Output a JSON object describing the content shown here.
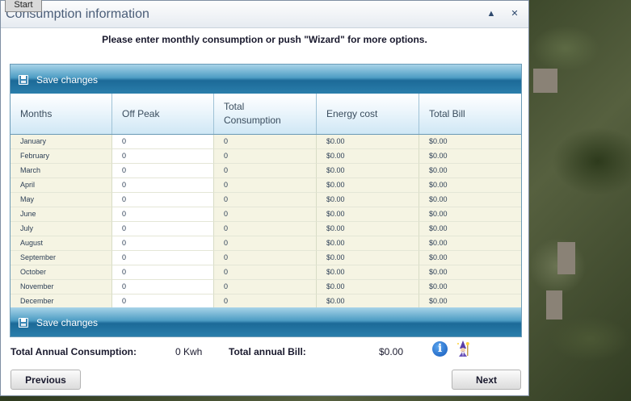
{
  "taskbar": {
    "start_label": "Start"
  },
  "dialog": {
    "title": "Consumption information",
    "collapse_glyph": "▲",
    "close_glyph": "✕",
    "instruction": "Please enter monthly consumption or push \"Wizard\" for more options."
  },
  "grid": {
    "save_label": "Save changes",
    "columns": [
      "Months",
      "Off Peak",
      "Total Consumption",
      "Energy cost",
      "Total Bill"
    ],
    "rows": [
      {
        "month": "January",
        "off_peak": "0",
        "total": "0",
        "energy": "$0.00",
        "bill": "$0.00"
      },
      {
        "month": "February",
        "off_peak": "0",
        "total": "0",
        "energy": "$0.00",
        "bill": "$0.00"
      },
      {
        "month": "March",
        "off_peak": "0",
        "total": "0",
        "energy": "$0.00",
        "bill": "$0.00"
      },
      {
        "month": "April",
        "off_peak": "0",
        "total": "0",
        "energy": "$0.00",
        "bill": "$0.00"
      },
      {
        "month": "May",
        "off_peak": "0",
        "total": "0",
        "energy": "$0.00",
        "bill": "$0.00"
      },
      {
        "month": "June",
        "off_peak": "0",
        "total": "0",
        "energy": "$0.00",
        "bill": "$0.00"
      },
      {
        "month": "July",
        "off_peak": "0",
        "total": "0",
        "energy": "$0.00",
        "bill": "$0.00"
      },
      {
        "month": "August",
        "off_peak": "0",
        "total": "0",
        "energy": "$0.00",
        "bill": "$0.00"
      },
      {
        "month": "September",
        "off_peak": "0",
        "total": "0",
        "energy": "$0.00",
        "bill": "$0.00"
      },
      {
        "month": "October",
        "off_peak": "0",
        "total": "0",
        "energy": "$0.00",
        "bill": "$0.00"
      },
      {
        "month": "November",
        "off_peak": "0",
        "total": "0",
        "energy": "$0.00",
        "bill": "$0.00"
      },
      {
        "month": "December",
        "off_peak": "0",
        "total": "0",
        "energy": "$0.00",
        "bill": "$0.00"
      }
    ]
  },
  "summary": {
    "consumption_label": "Total Annual Consumption:",
    "consumption_value": "0 Kwh",
    "bill_label": "Total annual Bill:",
    "bill_value": "$0.00"
  },
  "icons": {
    "info": "info-icon",
    "wizard": "wizard-icon"
  },
  "info_glyph": "i",
  "nav": {
    "previous_label": "Previous",
    "next_label": "Next"
  },
  "colors": {
    "toolbar": "#2a7eab",
    "row_bg": "#f5f4e3",
    "title": "#4a5d78"
  }
}
